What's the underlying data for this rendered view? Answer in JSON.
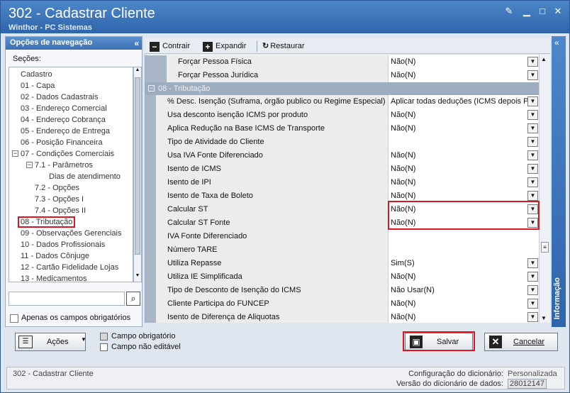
{
  "window": {
    "title": "302 - Cadastrar Cliente",
    "subtitle": "Winthor - PC Sistemas"
  },
  "nav": {
    "header": "Opções de navegação",
    "sections_label": "Seções:",
    "items": [
      {
        "label": "Cadastro",
        "level": 0
      },
      {
        "label": "01 - Capa",
        "level": 0
      },
      {
        "label": "02 - Dados Cadastrais",
        "level": 0
      },
      {
        "label": "03 - Endereço Comercial",
        "level": 0
      },
      {
        "label": "04 - Endereço Cobrança",
        "level": 0
      },
      {
        "label": "05 - Endereço de Entrega",
        "level": 0
      },
      {
        "label": "06 - Posição Financeira",
        "level": 0
      },
      {
        "label": "07 - Condições Comerciais",
        "level": 0
      },
      {
        "label": "7.1 - Parâmetros",
        "level": 1
      },
      {
        "label": "Dias de atendimento",
        "level": 2
      },
      {
        "label": "7.2 - Opções",
        "level": 1
      },
      {
        "label": "7.3 - Opções I",
        "level": 1
      },
      {
        "label": "7.4 - Opções II",
        "level": 1
      },
      {
        "label": "08 - Tributação",
        "level": 0,
        "selected": true
      },
      {
        "label": "09 - Observações Gerenciais",
        "level": 0
      },
      {
        "label": "10 - Dados Profissionais",
        "level": 0
      },
      {
        "label": "11 - Dados Cônjuge",
        "level": 0
      },
      {
        "label": "12 - Cartão Fidelidade Lojas",
        "level": 0
      },
      {
        "label": "13 - Medicamentos",
        "level": 0
      }
    ],
    "search_value": "",
    "only_required_label": "Apenas os campos obrigatórios"
  },
  "toolbar": {
    "collapse": "Contrair",
    "expand": "Expandir",
    "restore": "Restaurar"
  },
  "grid": {
    "top_rows": [
      {
        "label": "Forçar Pessoa Física",
        "value": "Não(N)"
      },
      {
        "label": "Forçar Pessoa Jurídica",
        "value": "Não(N)"
      }
    ],
    "group": "08 - Tributação",
    "rows": [
      {
        "label": "% Desc. Isenção (Suframa, órgão publico ou Regime Especial)",
        "value": "Aplicar todas deduções (ICMS depois PI",
        "dd": true
      },
      {
        "label": "Usa desconto isenção ICMS por produto",
        "value": "Não(N)",
        "dd": true
      },
      {
        "label": "Aplica Redução na Base ICMS de Transporte",
        "value": "Não(N)",
        "dd": true
      },
      {
        "label": "Tipo de Atividade do Cliente",
        "value": "",
        "dd": true
      },
      {
        "label": "Usa IVA Fonte Diferenciado",
        "value": "Não(N)",
        "dd": true
      },
      {
        "label": "Isento de ICMS",
        "value": "Não(N)",
        "dd": true
      },
      {
        "label": "Isento de IPI",
        "value": "Não(N)",
        "dd": true
      },
      {
        "label": "Isento de Taxa de Boleto",
        "value": "Não(N)",
        "dd": true
      },
      {
        "label": "Calcular ST",
        "value": "Não(N)",
        "dd": true
      },
      {
        "label": "Calcular ST Fonte",
        "value": "Não(N)",
        "dd": true
      },
      {
        "label": "IVA Fonte Diferenciado",
        "value": "",
        "dd": false
      },
      {
        "label": "Número TARE",
        "value": "",
        "dd": false
      },
      {
        "label": "Utiliza Repasse",
        "value": "Sim(S)",
        "dd": true
      },
      {
        "label": "Utiliza IE Simplificada",
        "value": "Não(N)",
        "dd": true
      },
      {
        "label": "Tipo de Desconto de Isenção do ICMS",
        "value": "Não Usar(N)",
        "dd": true
      },
      {
        "label": "Cliente Participa do FUNCEP",
        "value": "Não(N)",
        "dd": true
      },
      {
        "label": "Isento de Diferença de Aliquotas",
        "value": "Não(N)",
        "dd": true
      }
    ]
  },
  "side_tab": "Informação",
  "footer": {
    "actions": "Ações",
    "legend_required": "Campo obrigatório",
    "legend_readonly": "Campo não editável",
    "save": "Salvar",
    "cancel": "Cancelar"
  },
  "status": {
    "left": "302 - Cadastrar Cliente",
    "config_label": "Configuração do dicionário:",
    "config_value": "Personalizada",
    "version_label": "Versão do dicionário de dados:",
    "version_value": "28012147"
  }
}
